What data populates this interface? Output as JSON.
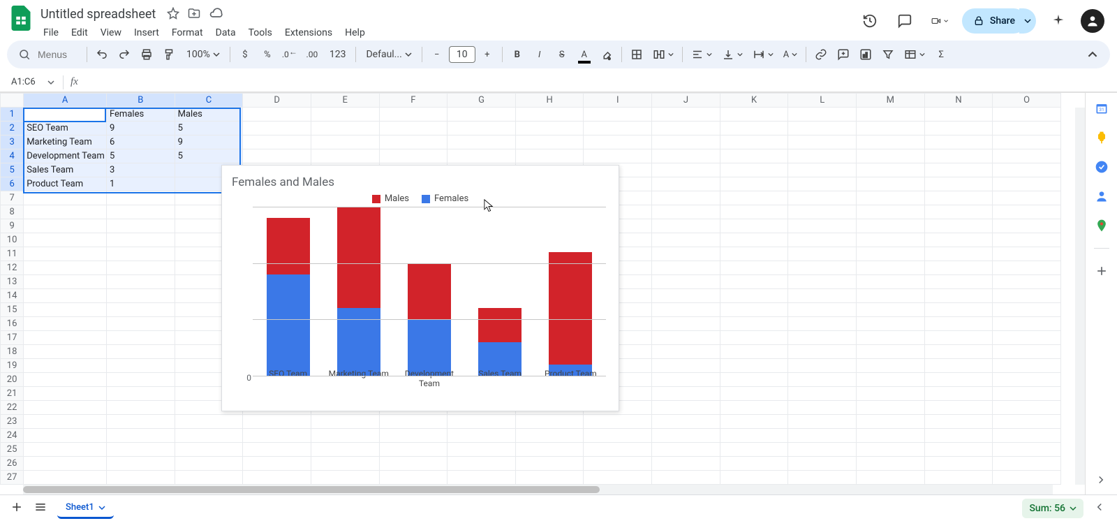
{
  "header": {
    "doc_title": "Untitled spreadsheet",
    "menus": [
      "File",
      "Edit",
      "View",
      "Insert",
      "Format",
      "Data",
      "Tools",
      "Extensions",
      "Help"
    ],
    "share_label": "Share"
  },
  "toolbar": {
    "search_placeholder": "Menus",
    "zoom": "100%",
    "font": "Defaul...",
    "font_size": "10"
  },
  "name_box": "A1:C6",
  "fx_value": "",
  "columns": [
    "A",
    "B",
    "C",
    "D",
    "E",
    "F",
    "G",
    "H",
    "I",
    "J",
    "K",
    "L",
    "M",
    "N",
    "O"
  ],
  "rows_count": 27,
  "selected_cols": [
    "A",
    "B",
    "C"
  ],
  "selected_rows": [
    1,
    2,
    3,
    4,
    5,
    6
  ],
  "cells": {
    "B1": "Females",
    "C1": "Males",
    "A2": "SEO Team",
    "B2": "9",
    "C2": "5",
    "A3": "Marketing Team",
    "B3": "6",
    "C3": "9",
    "A4": "Development Team",
    "B4": "5",
    "C4": "5",
    "A5": "Sales Team",
    "B5": "3",
    "A6": "Product Team",
    "B6": "1"
  },
  "chart_data": {
    "type": "bar",
    "stacked": true,
    "title": "Females and Males",
    "categories": [
      "SEO Team",
      "Marketing Team",
      "Development Team",
      "Sales Team",
      "Product Team"
    ],
    "series": [
      {
        "name": "Females",
        "color": "#3b78e7",
        "values": [
          9,
          6,
          5,
          3,
          1
        ]
      },
      {
        "name": "Males",
        "color": "#d2232a",
        "values": [
          5,
          9,
          5,
          3,
          10
        ]
      }
    ],
    "legend_order": [
      "Males",
      "Females"
    ],
    "ylim": [
      0,
      15
    ],
    "yticks": [
      0,
      5,
      10,
      15
    ]
  },
  "tabs": {
    "sheet1": "Sheet1"
  },
  "status": {
    "sum_label": "Sum: 56"
  }
}
